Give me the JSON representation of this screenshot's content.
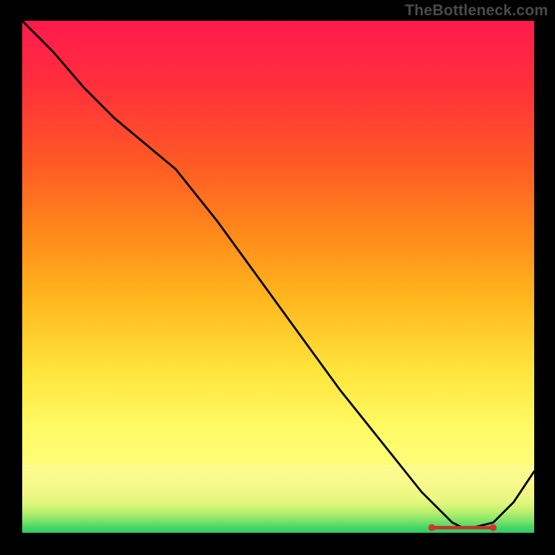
{
  "watermark": "TheBottleneck.com",
  "chart_data": {
    "type": "line",
    "title": "",
    "xlabel": "",
    "ylabel": "",
    "xlim": [
      0,
      100
    ],
    "ylim": [
      0,
      100
    ],
    "grid": false,
    "series": [
      {
        "name": "curve",
        "kind": "line",
        "x": [
          0,
          6,
          12,
          18,
          24,
          30,
          38,
          46,
          54,
          62,
          70,
          78,
          84,
          86,
          88,
          92,
          96,
          100
        ],
        "values": [
          100,
          94,
          87,
          81,
          76,
          71,
          61,
          50,
          39,
          28,
          18,
          8,
          2,
          1,
          1,
          2,
          6,
          12
        ]
      },
      {
        "name": "zero-band-markers",
        "kind": "scatter",
        "x": [
          80,
          81,
          82,
          83,
          84,
          85,
          86,
          87,
          88,
          89,
          90,
          91,
          92
        ],
        "values": [
          1,
          1,
          1,
          1,
          1,
          1,
          1,
          1,
          1,
          1,
          1,
          1,
          1
        ]
      }
    ],
    "background_bands": [
      {
        "y_from": 0.0,
        "y_to": 1.0,
        "type": "gradient_subtle"
      },
      {
        "y_from": 0.0,
        "y_to": 2.0,
        "color": "#2fd16b"
      },
      {
        "y_from": 2.0,
        "y_to": 4.0,
        "color": "#b5f06a"
      },
      {
        "y_from": 4.0,
        "y_to": 8.0,
        "color": "#f6f98a"
      },
      {
        "y_from": 8.0,
        "y_to": 12.0,
        "color": "#fffd91"
      }
    ]
  }
}
